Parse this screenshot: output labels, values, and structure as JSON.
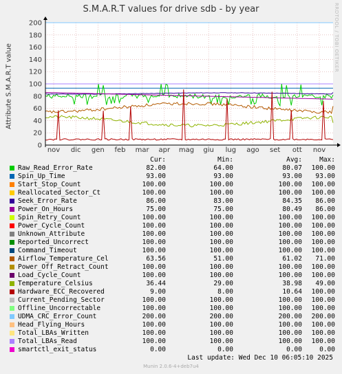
{
  "chart_data": {
    "type": "line",
    "title": "S.M.A.R.T values for drive sdb - by year",
    "ylabel": "Attribute S.M.A.R.T value",
    "xlabel": "",
    "ylim": [
      0,
      200
    ],
    "yticks": [
      0,
      20,
      40,
      60,
      80,
      100,
      120,
      140,
      160,
      180,
      200
    ],
    "xticks": [
      "nov",
      "dic",
      "gen",
      "feb",
      "mar",
      "apr",
      "mag",
      "giu",
      "lug",
      "ago",
      "set",
      "ott",
      "nov"
    ],
    "grid": true,
    "legend_placement": "bottom",
    "columns": [
      "Cur:",
      "Min:",
      "Avg:",
      "Max:"
    ],
    "series": [
      {
        "name": "Raw_Read_Error_Rate",
        "color": "#00cc00",
        "cur": "82.00",
        "min": "64.00",
        "avg": "80.07",
        "max": "100.00"
      },
      {
        "name": "Spin_Up_Time",
        "color": "#0066b3",
        "cur": "93.00",
        "min": "93.00",
        "avg": "93.00",
        "max": "93.00"
      },
      {
        "name": "Start_Stop_Count",
        "color": "#ff8000",
        "cur": "100.00",
        "min": "100.00",
        "avg": "100.00",
        "max": "100.00"
      },
      {
        "name": "Reallocated_Sector_Ct",
        "color": "#ffcc00",
        "cur": "100.00",
        "min": "100.00",
        "avg": "100.00",
        "max": "100.00"
      },
      {
        "name": "Seek_Error_Rate",
        "color": "#330099",
        "cur": "86.00",
        "min": "83.00",
        "avg": "84.35",
        "max": "86.00"
      },
      {
        "name": "Power_On_Hours",
        "color": "#990099",
        "cur": "75.00",
        "min": "75.00",
        "avg": "80.49",
        "max": "86.00"
      },
      {
        "name": "Spin_Retry_Count",
        "color": "#ccff00",
        "cur": "100.00",
        "min": "100.00",
        "avg": "100.00",
        "max": "100.00"
      },
      {
        "name": "Power_Cycle_Count",
        "color": "#ff0000",
        "cur": "100.00",
        "min": "100.00",
        "avg": "100.00",
        "max": "100.00"
      },
      {
        "name": "Unknown_Attribute",
        "color": "#808080",
        "cur": "100.00",
        "min": "100.00",
        "avg": "100.00",
        "max": "100.00"
      },
      {
        "name": "Reported_Uncorrect",
        "color": "#008f00",
        "cur": "100.00",
        "min": "100.00",
        "avg": "100.00",
        "max": "100.00"
      },
      {
        "name": "Command_Timeout",
        "color": "#00487d",
        "cur": "100.00",
        "min": "100.00",
        "avg": "100.00",
        "max": "100.00"
      },
      {
        "name": "Airflow_Temperature_Cel",
        "color": "#b35a00",
        "cur": "63.56",
        "min": "51.00",
        "avg": "61.02",
        "max": "71.00"
      },
      {
        "name": "Power_Off_Retract_Count",
        "color": "#b38f00",
        "cur": "100.00",
        "min": "100.00",
        "avg": "100.00",
        "max": "100.00"
      },
      {
        "name": "Load_Cycle_Count",
        "color": "#6b006b",
        "cur": "100.00",
        "min": "100.00",
        "avg": "100.00",
        "max": "100.00"
      },
      {
        "name": "Temperature_Celsius",
        "color": "#8fb300",
        "cur": "36.44",
        "min": "29.00",
        "avg": "38.98",
        "max": "49.00"
      },
      {
        "name": "Hardware_ECC_Recovered",
        "color": "#b30000",
        "cur": "9.00",
        "min": "8.00",
        "avg": "10.64",
        "max": "100.00"
      },
      {
        "name": "Current_Pending_Sector",
        "color": "#bebebe",
        "cur": "100.00",
        "min": "100.00",
        "avg": "100.00",
        "max": "100.00"
      },
      {
        "name": "Offline_Uncorrectable",
        "color": "#80ff80",
        "cur": "100.00",
        "min": "100.00",
        "avg": "100.00",
        "max": "100.00"
      },
      {
        "name": "UDMA_CRC_Error_Count",
        "color": "#80c9ff",
        "cur": "200.00",
        "min": "200.00",
        "avg": "200.00",
        "max": "200.00"
      },
      {
        "name": "Head_Flying_Hours",
        "color": "#ffc080",
        "cur": "100.00",
        "min": "100.00",
        "avg": "100.00",
        "max": "100.00"
      },
      {
        "name": "Total_LBAs_Written",
        "color": "#ffe680",
        "cur": "100.00",
        "min": "100.00",
        "avg": "100.00",
        "max": "100.00"
      },
      {
        "name": "Total_LBAs_Read",
        "color": "#aa80ff",
        "cur": "100.00",
        "min": "100.00",
        "avg": "100.00",
        "max": "100.00"
      },
      {
        "name": "smartctl_exit_status",
        "color": "#ee00cc",
        "cur": "0.00",
        "min": "0.00",
        "avg": "0.00",
        "max": "0.00"
      }
    ]
  },
  "footer": {
    "last_update": "Last update: Wed Dec 10 06:05:10 2025",
    "munin_version": "Munin 2.0.6-4+deb7u4"
  },
  "watermark": "RRDTOOL / TOBI OETIKER"
}
